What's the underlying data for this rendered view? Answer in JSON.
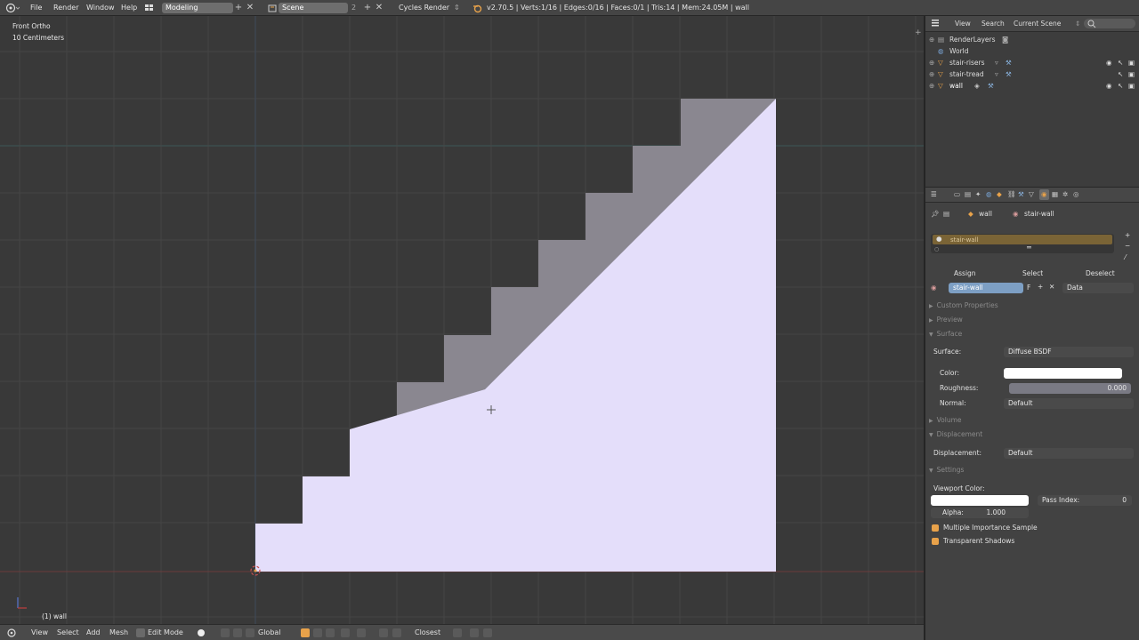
{
  "topbar": {
    "menus": [
      "File",
      "Render",
      "Window",
      "Help"
    ],
    "screen_layout": "Modeling",
    "scene": "Scene",
    "scene_count": "2",
    "render_engine": "Cycles Render",
    "stats": "v2.70.5 | Verts:1/16 | Edges:0/16 | Faces:0/1 | Tris:14 | Mem:24.05M | wall"
  },
  "viewport": {
    "view_name": "Front Ortho",
    "grid_scale": "10 Centimeters",
    "object_label": "(1) wall",
    "colors": {
      "face": "#e4defa",
      "shadow": "#8a8790",
      "background": "#393939"
    }
  },
  "bottombar": {
    "view": "View",
    "select": "Select",
    "add": "Add",
    "mesh": "Mesh",
    "mode": "Edit Mode",
    "orientation": "Global",
    "snap_target": "Closest"
  },
  "outliner": {
    "header": {
      "view": "View",
      "search": "Search",
      "scene_filter": "Current Scene"
    },
    "items": [
      {
        "label": "RenderLayers",
        "icon": "render-layers-icon"
      },
      {
        "label": "World",
        "icon": "world-icon"
      },
      {
        "label": "stair-risers",
        "icon": "mesh-icon"
      },
      {
        "label": "stair-tread",
        "icon": "mesh-icon"
      },
      {
        "label": "wall",
        "icon": "mesh-icon"
      }
    ]
  },
  "properties": {
    "context_object": "wall",
    "context_material": "stair-wall",
    "material_slot": "stair-wall",
    "assign": "Assign",
    "select": "Select",
    "deselect": "Deselect",
    "material_name": "stair-wall",
    "fake_user": "F",
    "link": "Data",
    "panels": {
      "custom_properties": "Custom Properties",
      "preview": "Preview",
      "surface": "Surface",
      "volume": "Volume",
      "displacement": "Displacement",
      "settings": "Settings"
    },
    "surface_label": "Surface:",
    "surface_value": "Diffuse BSDF",
    "color_label": "Color:",
    "color_value": "#ffffff",
    "roughness_label": "Roughness:",
    "roughness_value": "0.000",
    "normal_label": "Normal:",
    "normal_value": "Default",
    "displacement_label": "Displacement:",
    "displacement_value": "Default",
    "viewport_color_label": "Viewport Color:",
    "pass_index_label": "Pass Index:",
    "pass_index_value": "0",
    "alpha_label": "Alpha:",
    "alpha_value": "1.000",
    "mis_label": "Multiple Importance Sample",
    "transparent_shadows_label": "Transparent Shadows"
  }
}
